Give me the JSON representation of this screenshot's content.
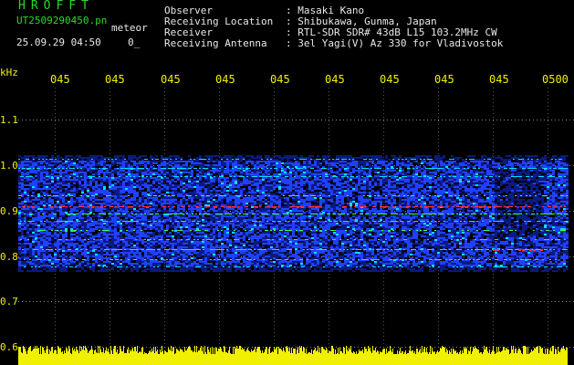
{
  "header": {
    "brand": "HROFFT",
    "filename": "UT2509290450.pn",
    "filetype": "meteor",
    "datetime": "25.09.29 04:50",
    "dot_label": "0_"
  },
  "info": [
    {
      "label": "Observer",
      "value": ": Masaki Kano"
    },
    {
      "label": "Receiving Location",
      "value": ": Shibukawa, Gunma, Japan"
    },
    {
      "label": "Receiver",
      "value": ": RTL-SDR SDR# 43dB L15 103.2MHz CW"
    },
    {
      "label": "Receiving Antenna",
      "value": ": 3el Yagi(V) Az 330 for Vladivostok"
    }
  ],
  "axis": {
    "y_unit": "kHz",
    "y_ticks": [
      "1.1",
      "1.0",
      "0.9",
      "0.8",
      "0.7",
      "0.6"
    ],
    "x_ticks": [
      "045",
      "045",
      "045",
      "045",
      "045",
      "045",
      "045",
      "045",
      "045",
      "0500"
    ]
  },
  "colors": {
    "text_green": "#22dd22",
    "axis_yellow": "#f0f000",
    "background": "#000000",
    "noise_dark_blue": "#0a1a80",
    "noise_blue": "#2040ff",
    "trace_cyan": "#00e0ff",
    "trace_green": "#40ff40",
    "trace_red": "#ff3030"
  }
}
